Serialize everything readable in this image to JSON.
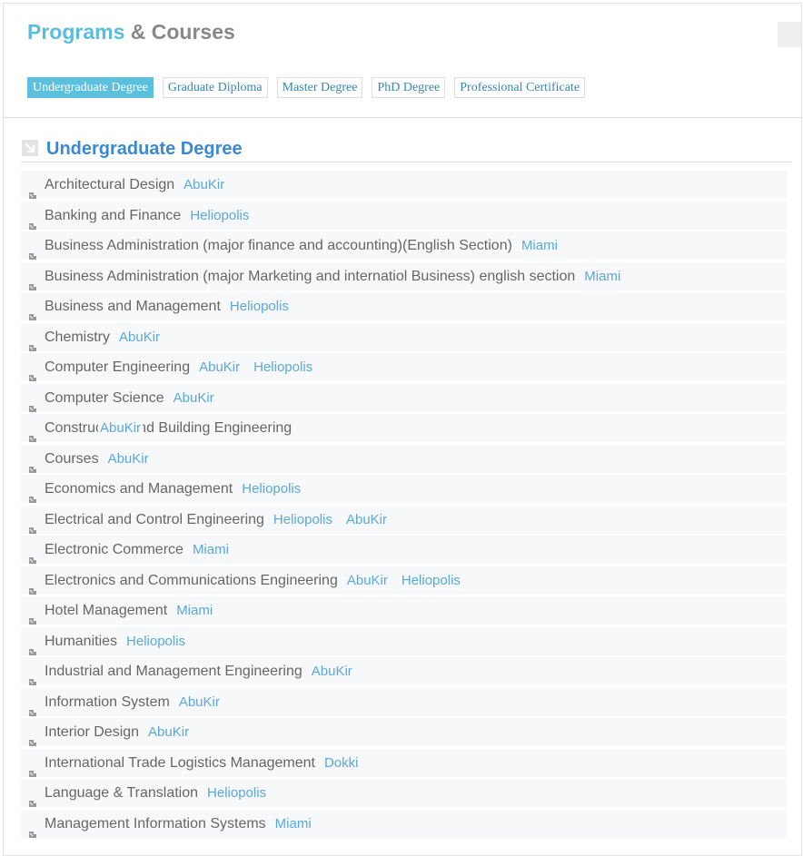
{
  "header": {
    "title_accent": "Programs",
    "title_rest": "& Courses"
  },
  "tabs": [
    {
      "label": "Undergraduate Degree",
      "active": true
    },
    {
      "label": "Graduate Diploma",
      "active": false
    },
    {
      "label": "Master Degree",
      "active": false
    },
    {
      "label": "PhD Degree",
      "active": false
    },
    {
      "label": "Professional Certificate",
      "active": false
    }
  ],
  "section": {
    "title": "Undergraduate Degree",
    "icon": "arrow-down-right-icon"
  },
  "courses": [
    {
      "name": "Architectural Design",
      "campuses": [
        "AbuKir"
      ]
    },
    {
      "name": "Banking and Finance",
      "campuses": [
        "Heliopolis"
      ]
    },
    {
      "name": "Business Administration (major finance and accounting)(English Section)",
      "campuses": [
        "Miami"
      ]
    },
    {
      "name": "Business Administration (major Marketing and internatiol Business) english section",
      "campuses": [
        "Miami"
      ]
    },
    {
      "name": "Business and Management",
      "campuses": [
        "Heliopolis"
      ]
    },
    {
      "name": "Chemistry",
      "campuses": [
        "AbuKir"
      ]
    },
    {
      "name": "Computer Engineering",
      "campuses": [
        "AbuKir",
        "Heliopolis"
      ]
    },
    {
      "name": "Computer Science",
      "campuses": [
        "AbuKir"
      ]
    },
    {
      "name": "Construction and Building Engineering",
      "campuses": [
        "AbuKir"
      ],
      "overlap": true
    },
    {
      "name": "Courses",
      "campuses": [
        "AbuKir"
      ]
    },
    {
      "name": "Economics and Management",
      "campuses": [
        "Heliopolis"
      ]
    },
    {
      "name": "Electrical and Control Engineering",
      "campuses": [
        "Heliopolis",
        "AbuKir"
      ]
    },
    {
      "name": "Electronic Commerce",
      "campuses": [
        "Miami"
      ]
    },
    {
      "name": "Electronics and Communications Engineering",
      "campuses": [
        "AbuKir",
        "Heliopolis"
      ]
    },
    {
      "name": "Hotel Management",
      "campuses": [
        "Miami"
      ]
    },
    {
      "name": "Humanities",
      "campuses": [
        "Heliopolis"
      ]
    },
    {
      "name": "Industrial and Management Engineering",
      "campuses": [
        "AbuKir"
      ]
    },
    {
      "name": "Information System",
      "campuses": [
        "AbuKir"
      ]
    },
    {
      "name": "Interior Design",
      "campuses": [
        "AbuKir"
      ]
    },
    {
      "name": "International Trade Logistics Management",
      "campuses": [
        "Dokki"
      ]
    },
    {
      "name": "Language & Translation",
      "campuses": [
        "Heliopolis"
      ]
    },
    {
      "name": "Management Information Systems",
      "campuses": [
        "Miami"
      ]
    }
  ],
  "colors": {
    "accent": "#5bbbe0",
    "section_title": "#3a8ad3",
    "campus_link": "#5aa8da"
  }
}
